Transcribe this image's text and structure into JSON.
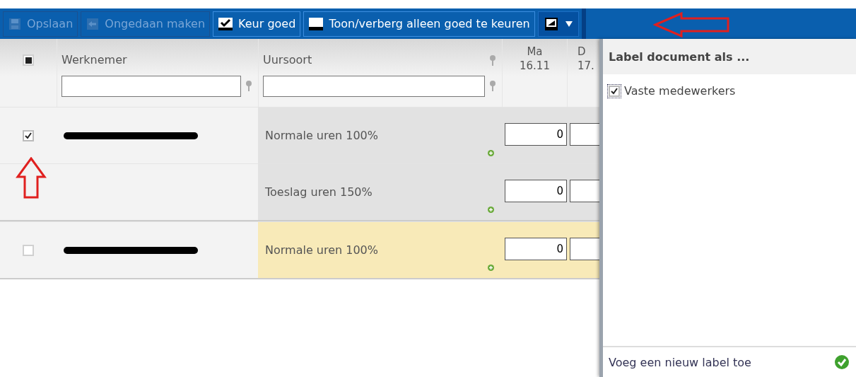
{
  "toolbar": {
    "buttons": [
      {
        "kind": "save",
        "label": "Opslaan",
        "disabled": true
      },
      {
        "kind": "undo",
        "label": "Ongedaan maken",
        "disabled": true
      },
      {
        "kind": "approve",
        "label": "Keur goed",
        "disabled": false
      },
      {
        "kind": "toggle",
        "label": "Toon/verberg alleen goed te keuren",
        "disabled": false
      }
    ],
    "label_menu": {
      "expanded": true
    }
  },
  "table": {
    "select_all": {
      "partial": true
    },
    "columns": [
      "Werknemer",
      "Uursoort"
    ],
    "days": [
      {
        "day": "Ma",
        "date": "16.11"
      },
      {
        "day": "D",
        "date": "17."
      }
    ],
    "rows": [
      {
        "checked": true,
        "highlighted": false,
        "entries": [
          {
            "label": "Normale uren 100%",
            "value": "0"
          },
          {
            "label": "Toeslag uren 150%",
            "value": "0"
          }
        ]
      },
      {
        "checked": false,
        "highlighted": true,
        "entries": [
          {
            "label": "Normale uren 100%",
            "value": "0"
          }
        ]
      }
    ]
  },
  "label_panel": {
    "title": "Label document als ...",
    "items": [
      {
        "label": "Vaste medewerkers",
        "checked": true
      }
    ],
    "footer": "Voeg een nieuw label toe"
  }
}
